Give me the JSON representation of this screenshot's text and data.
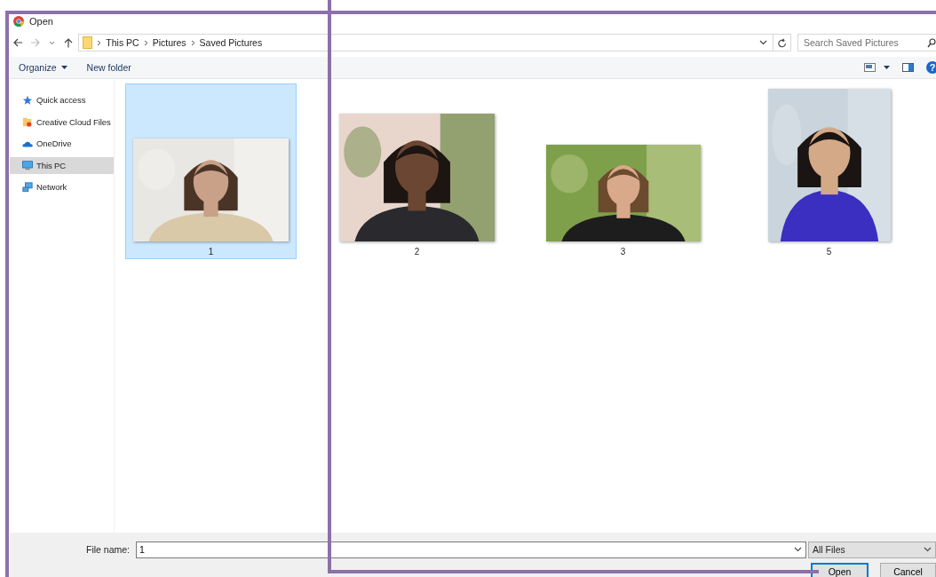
{
  "window": {
    "title": "Open"
  },
  "address_bar": {
    "path": [
      "This PC",
      "Pictures",
      "Saved Pictures"
    ]
  },
  "search": {
    "placeholder": "Search Saved Pictures"
  },
  "toolbar": {
    "organize": "Organize",
    "new_folder": "New folder",
    "help": "?"
  },
  "sidebar": {
    "items": [
      {
        "label": "Quick access",
        "kind": "star",
        "selected": false
      },
      {
        "label": "Creative Cloud Files",
        "kind": "cloudfolder",
        "selected": false
      },
      {
        "label": "OneDrive",
        "kind": "cloud",
        "selected": false
      },
      {
        "label": "This PC",
        "kind": "pc",
        "selected": true
      },
      {
        "label": "Network",
        "kind": "network",
        "selected": false
      }
    ]
  },
  "files": [
    {
      "label": "1",
      "kind": "picture",
      "selected": true
    },
    {
      "label": "2",
      "kind": "picture",
      "selected": false
    },
    {
      "label": "3",
      "kind": "picture",
      "selected": false
    },
    {
      "label": "5",
      "kind": "picture",
      "selected": false
    }
  ],
  "file_name": {
    "label": "File name:",
    "value": "1"
  },
  "file_type": {
    "value": "All Files"
  },
  "buttons": [
    {
      "label": "Open",
      "kind": "default"
    },
    {
      "label": "Cancel",
      "kind": "normal"
    }
  ]
}
